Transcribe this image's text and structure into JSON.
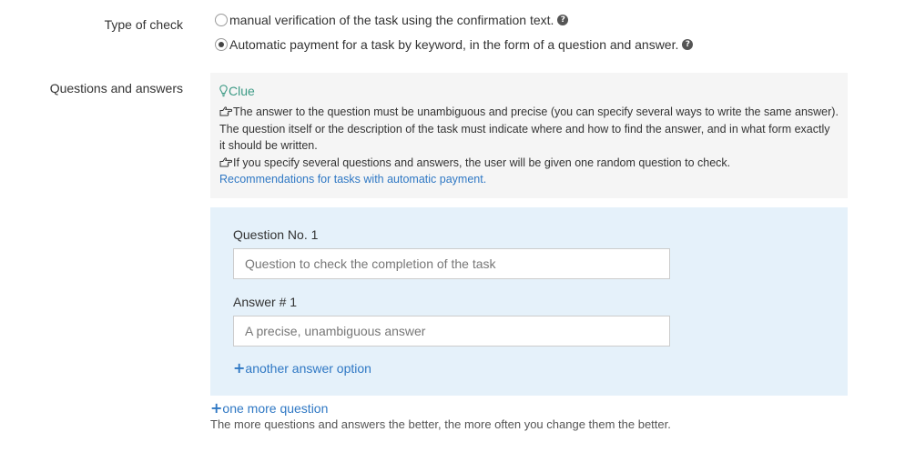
{
  "check_type": {
    "label": "Type of check",
    "options": [
      {
        "text": "manual verification of the task using the confirmation text.",
        "selected": false
      },
      {
        "text": "Automatic payment for a task by keyword, in the form of a question and answer.",
        "selected": true
      }
    ],
    "help_icon": "question-circle-icon"
  },
  "questions_answers": {
    "label": "Questions and answers",
    "hint": {
      "title": "Clue",
      "icon": "lightbulb-icon",
      "bullet_icon": "hand-pointing-icon",
      "items": [
        "The answer to the question must be unambiguous and precise (you can specify several ways to write the same answer). The question itself or the description of the task must indicate where and how to find the answer, and in what form exactly it should be written.",
        "If you specify several questions and answers, the user will be given one random question to check."
      ],
      "link": "Recommendations for tasks with automatic payment."
    },
    "question_block": {
      "question_label": "Question No. 1",
      "question_placeholder": "Question to check the completion of the task",
      "answer_label": "Answer # 1",
      "answer_placeholder": "A precise, unambiguous answer",
      "add_answer": "another answer option"
    },
    "add_question": "one more question",
    "footnote": "The more questions and answers the better, the more often you change them the better."
  },
  "colors": {
    "accent_link": "#2f78c4",
    "hint_title": "#3c9a85",
    "hint_background": "#f5f5f5",
    "panel_background": "#e5f1fa"
  }
}
